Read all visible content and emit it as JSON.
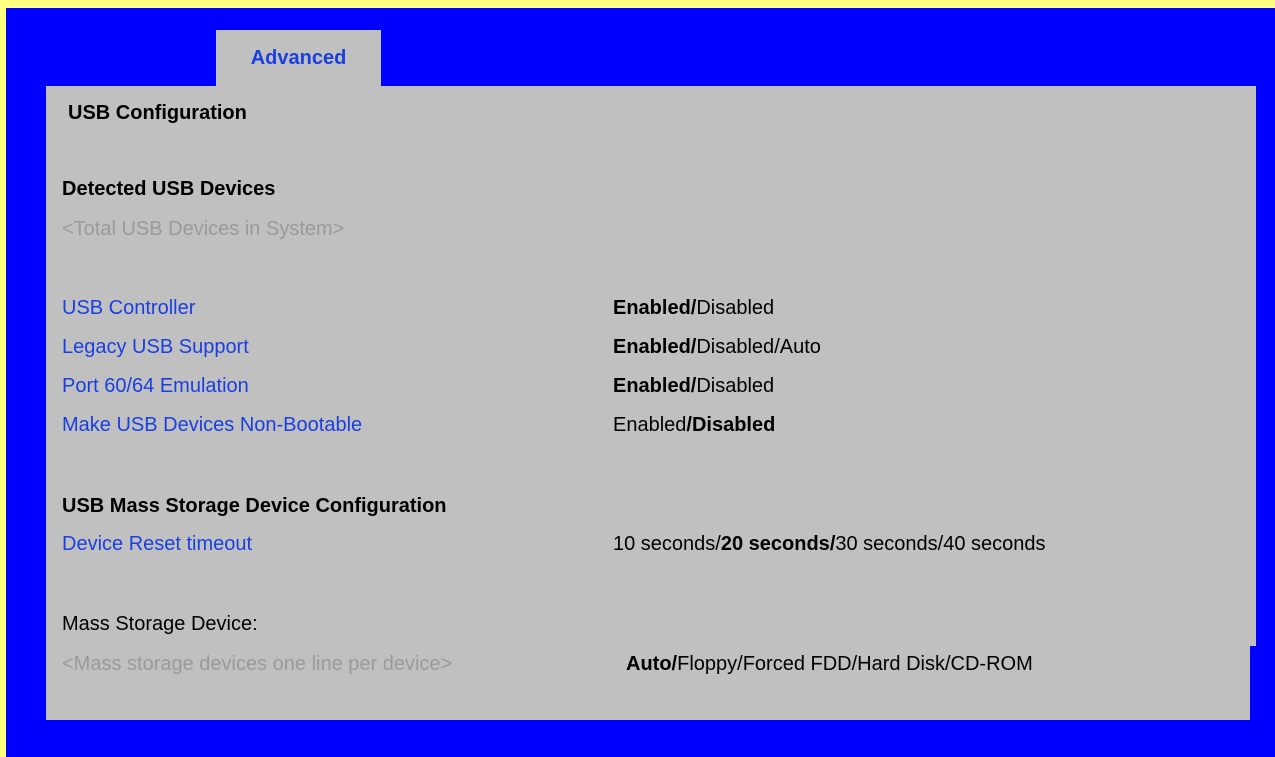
{
  "tab": {
    "label": "Advanced"
  },
  "page": {
    "title": "USB Configuration"
  },
  "detected": {
    "heading": "Detected USB Devices",
    "placeholder": "<Total USB Devices in System>"
  },
  "settings": [
    {
      "label": "USB Controller",
      "options": [
        "Enabled",
        "Disabled"
      ],
      "default": "Enabled"
    },
    {
      "label": "Legacy USB Support",
      "options": [
        "Enabled",
        "Disabled",
        "Auto"
      ],
      "default": "Enabled"
    },
    {
      "label": "Port 60/64 Emulation",
      "options": [
        "Enabled",
        "Disabled"
      ],
      "default": "Enabled"
    },
    {
      "label": "Make USB Devices Non-Bootable",
      "options": [
        "Enabled",
        "Disabled"
      ],
      "default": "Disabled"
    }
  ],
  "mass_storage_config": {
    "heading": "USB Mass Storage Device Configuration",
    "reset_timeout": {
      "label": "Device Reset timeout",
      "options": [
        "10 seconds",
        "20 seconds",
        "30 seconds",
        "40 seconds"
      ],
      "default": "20 seconds"
    }
  },
  "mass_storage_device": {
    "heading": "Mass Storage Device:",
    "placeholder": "<Mass storage devices one line per device>",
    "options": [
      "Auto",
      "Floppy",
      "Forced FDD",
      "Hard Disk",
      "CD-ROM"
    ],
    "default": "Auto"
  },
  "colors": {
    "background": "#0000ff",
    "panel": "#c0c0c0",
    "link": "#1a3fe0",
    "disabled_text": "#9a9a9a",
    "outer_border": "#ffff80"
  }
}
